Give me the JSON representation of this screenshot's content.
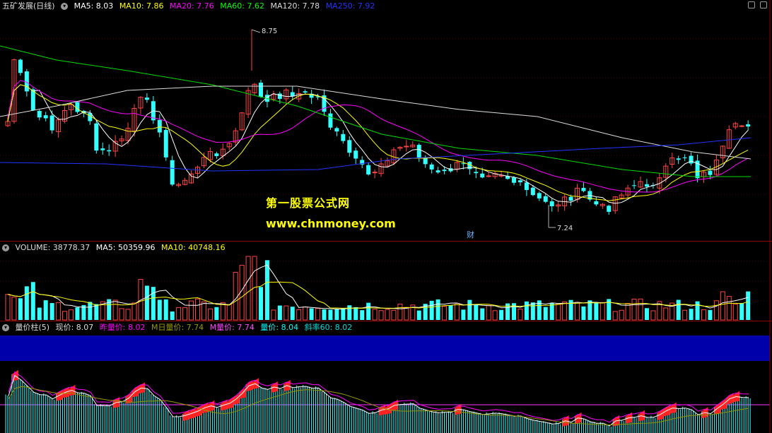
{
  "price_panel": {
    "title": "五矿发展(日线)",
    "indicators": [
      {
        "label": "MA5: 8.03",
        "color": "#ffffff"
      },
      {
        "label": "MA10: 7.86",
        "color": "#ffff00"
      },
      {
        "label": "MA20: 7.76",
        "color": "#ff00ff"
      },
      {
        "label": "MA60: 7.62",
        "color": "#00ff00"
      },
      {
        "label": "MA120: 7.78",
        "color": "#dddddd"
      },
      {
        "label": "MA250: 7.92",
        "color": "#2233ff"
      }
    ],
    "high_label": "8.75",
    "low_label": "7.24",
    "event_marker": "财"
  },
  "watermark": {
    "line1": "第一股票公式网",
    "line2": "www.chnmoney.com"
  },
  "volume_panel": {
    "title": "VOLUME: 38778.37",
    "indicators": [
      {
        "label": "MA5: 50359.96",
        "color": "#ffffff"
      },
      {
        "label": "MA10: 40748.16",
        "color": "#ffff00"
      }
    ]
  },
  "indicator_panel": {
    "title": "量价柱(5)",
    "indicators": [
      {
        "label": "现价: 8.07",
        "color": "#dddddd"
      },
      {
        "label": "昨量价: 8.02",
        "color": "#ff00ff"
      },
      {
        "label": "M日量价: 7.74",
        "color": "#999900"
      },
      {
        "label": "M量价: 7.74",
        "color": "#ff44ff"
      },
      {
        "label": "量价: 8.04",
        "color": "#00ffff"
      },
      {
        "label": "斜率60: 8.02",
        "color": "#00dddd"
      }
    ]
  },
  "colors": {
    "up": "#ff4444",
    "down": "#33ffff",
    "grid": "#8b0000",
    "band": "#0000aa"
  }
}
